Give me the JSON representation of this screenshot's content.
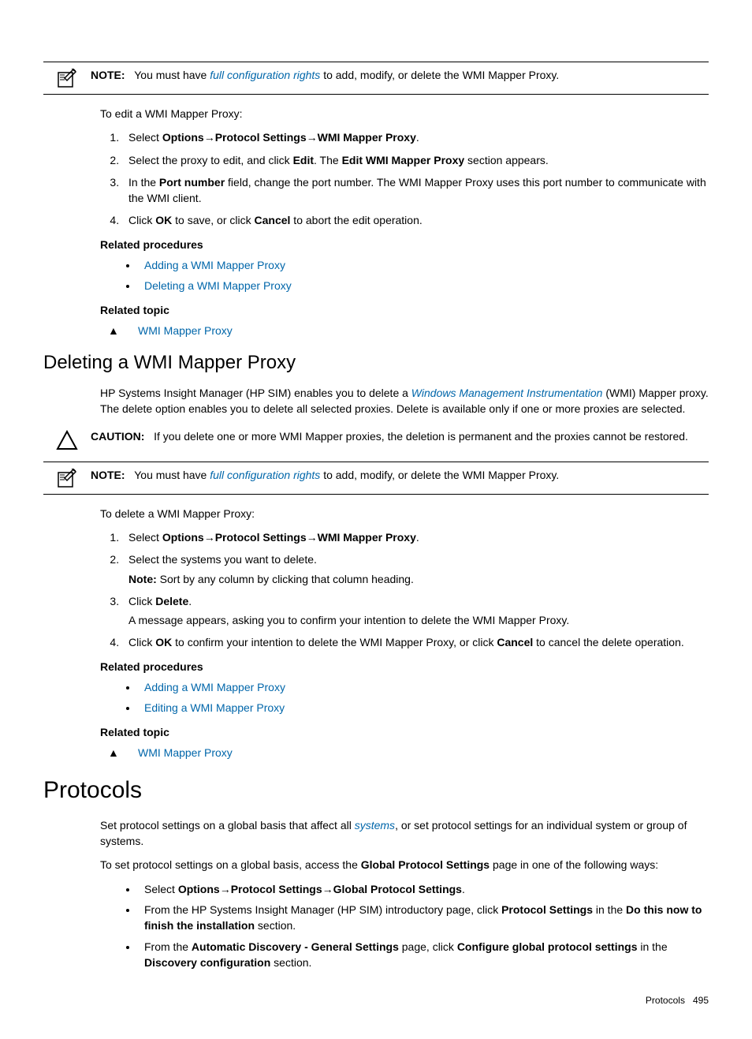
{
  "note1": {
    "label": "NOTE:",
    "pre": "You must have ",
    "italic": "full configuration rights",
    "post": " to add, modify, or delete the WMI Mapper Proxy."
  },
  "edit_intro": "To edit a WMI Mapper Proxy:",
  "edit_steps": {
    "s1a": "Select ",
    "s1b": "Options",
    "s1c": "Protocol Settings",
    "s1d": "WMI Mapper Proxy",
    "s2a": "Select the proxy to edit, and click ",
    "s2b": "Edit",
    "s2c": ". The ",
    "s2d": "Edit WMI Mapper Proxy",
    "s2e": " section appears.",
    "s3a": "In the ",
    "s3b": "Port number",
    "s3c": " field, change the port number. The WMI Mapper Proxy uses this port number to communicate with the WMI client.",
    "s4a": "Click ",
    "s4b": "OK",
    "s4c": " to save, or click ",
    "s4d": "Cancel",
    "s4e": " to abort the edit operation."
  },
  "related_proc_label": "Related procedures",
  "related_topic_label": "Related topic",
  "links1": {
    "adding": "Adding a WMI Mapper Proxy",
    "deleting": "Deleting a WMI Mapper Proxy",
    "wmi": "WMI Mapper Proxy"
  },
  "h2_delete": "Deleting a WMI Mapper Proxy",
  "delete_intro": {
    "pre": "HP Systems Insight Manager (HP SIM) enables you to delete a ",
    "italic": "Windows Management Instrumentation",
    "post": " (WMI) Mapper proxy. The delete option enables you to delete all selected proxies. Delete is available only if one or more proxies are selected."
  },
  "caution": {
    "label": "CAUTION:",
    "text": "If you delete one or more WMI Mapper proxies, the deletion is permanent and the proxies cannot be restored."
  },
  "delete_intro2": "To delete a WMI Mapper Proxy:",
  "delete_steps": {
    "s1a": "Select ",
    "s1b": "Options",
    "s1c": "Protocol Settings",
    "s1d": "WMI Mapper Proxy",
    "s2": "Select the systems you want to delete.",
    "s2note_label": "Note:",
    "s2note_text": " Sort by any column by clicking that column heading.",
    "s3a": "Click ",
    "s3b": "Delete",
    "s3msg": "A message appears, asking you to confirm your intention to delete the WMI Mapper Proxy.",
    "s4a": "Click ",
    "s4b": "OK",
    "s4c": " to confirm your intention to delete the WMI Mapper Proxy, or click ",
    "s4d": "Cancel",
    "s4e": " to cancel the delete operation."
  },
  "links2": {
    "adding": "Adding a WMI Mapper Proxy",
    "editing": "Editing a WMI Mapper Proxy",
    "wmi": "WMI Mapper Proxy"
  },
  "h1_protocols": "Protocols",
  "protocols_p1": {
    "pre": "Set protocol settings on a global basis that affect all ",
    "italic": "systems",
    "post": ", or set protocol settings for an individual system or group of systems."
  },
  "protocols_p2": {
    "pre": "To set protocol settings on a global basis, access the ",
    "bold": "Global Protocol Settings",
    "post": " page in one of the following ways:"
  },
  "protocols_bullets": {
    "b1a": "Select ",
    "b1b": "Options",
    "b1c": "Protocol Settings",
    "b1d": "Global Protocol Settings",
    "b2a": "From the HP Systems Insight Manager (HP SIM) introductory page, click ",
    "b2b": "Protocol Settings",
    "b2c": " in the ",
    "b2d": "Do this now to finish the installation",
    "b2e": " section.",
    "b3a": "From the ",
    "b3b": "Automatic Discovery - General Settings",
    "b3c": " page, click ",
    "b3d": "Configure global protocol settings",
    "b3e": " in the ",
    "b3f": "Discovery configuration",
    "b3g": " section."
  },
  "footer": {
    "label": "Protocols",
    "page": "495"
  }
}
